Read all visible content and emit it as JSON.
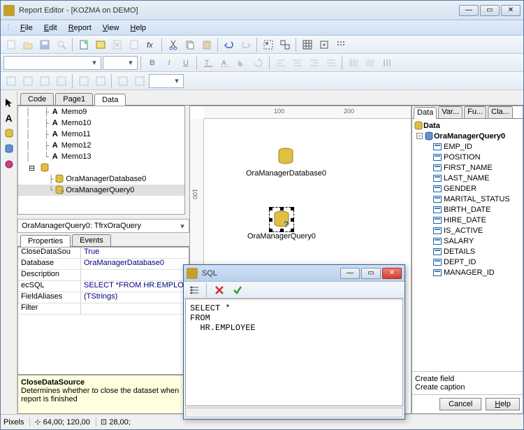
{
  "window": {
    "title": "Report Editor - [KOZMA on DEMO]"
  },
  "menus": [
    "File",
    "Edit",
    "Report",
    "View",
    "Help"
  ],
  "tabs": {
    "code": "Code",
    "page1": "Page1",
    "data": "Data"
  },
  "tree_items": [
    "Memo9",
    "Memo10",
    "Memo11",
    "Memo12",
    "Memo13"
  ],
  "tree_db": "OraManagerDatabase0",
  "tree_q": "OraManagerQuery0",
  "prop_combo": "OraManagerQuery0: TfrxOraQuery",
  "prop_tabs": {
    "p": "Properties",
    "e": "Events"
  },
  "props": [
    {
      "n": "CloseDataSou",
      "v": "True"
    },
    {
      "n": "Database",
      "v": "OraManagerDatabase0"
    },
    {
      "n": "Description",
      "v": ""
    },
    {
      "n": "ecSQL",
      "v": "SELECT *FROM  HR.EMPLOY"
    },
    {
      "n": "FieldAliases",
      "v": "(TStrings)"
    },
    {
      "n": "Filter",
      "v": ""
    }
  ],
  "desc": {
    "title": "CloseDataSource",
    "body": "Determines whether to close the dataset when report is finished"
  },
  "ruler": {
    "m100": "100",
    "m200": "200",
    "v100": "100"
  },
  "canvas": {
    "db": "OraManagerDatabase0",
    "q": "OraManagerQuery0"
  },
  "right_tabs": [
    "Data",
    "Var...",
    "Fu...",
    "Cla..."
  ],
  "right_root": "Data",
  "right_q": "OraManagerQuery0",
  "fields": [
    "EMP_ID",
    "POSITION",
    "FIRST_NAME",
    "LAST_NAME",
    "GENDER",
    "MARITAL_STATUS",
    "BIRTH_DATE",
    "HIRE_DATE",
    "IS_ACTIVE",
    "SALARY",
    "DETAILS",
    "DEPT_ID",
    "MANAGER_ID"
  ],
  "right_actions": {
    "cf": "Create field",
    "cc": "Create caption"
  },
  "buttons": {
    "cancel": "Cancel",
    "help": "Help"
  },
  "status": {
    "label": "Pixels",
    "coord1": "64,00; 120,00",
    "coord2": "28,00;"
  },
  "sql": {
    "title": "SQL",
    "body": "SELECT *\nFROM\n  HR.EMPLOYEE"
  }
}
